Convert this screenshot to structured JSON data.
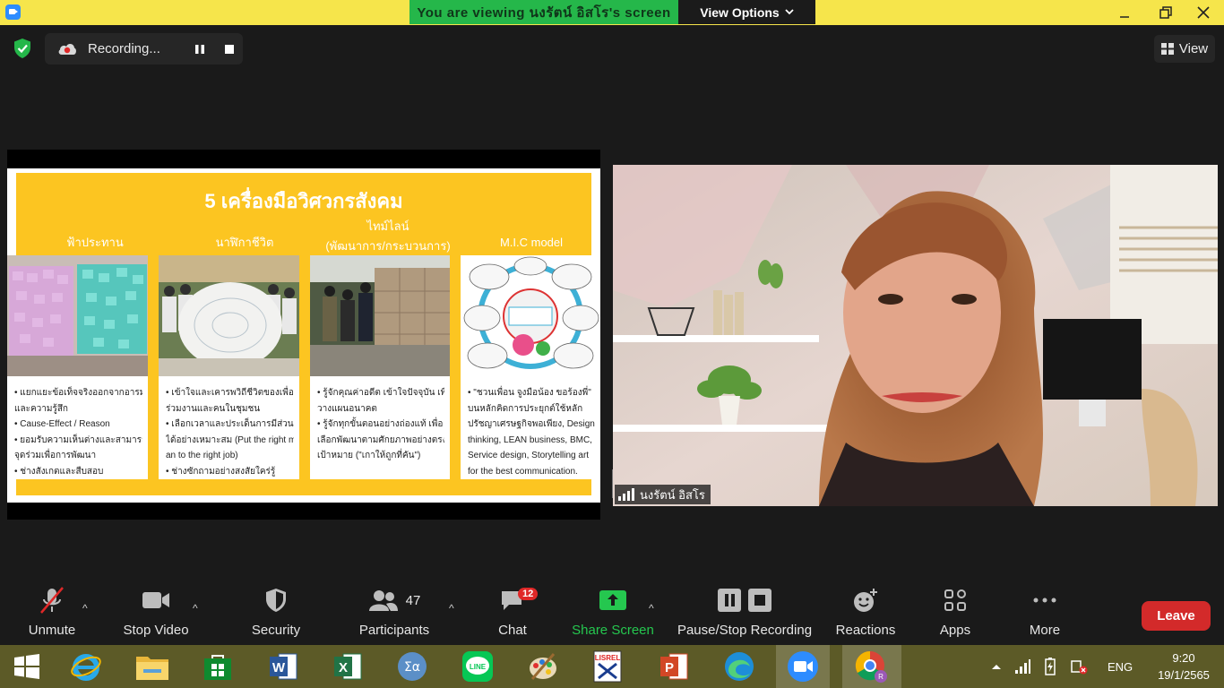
{
  "titlebar": {
    "banner_text": "You are viewing นงรัตน์ อิสโร's screen",
    "view_options": "View Options"
  },
  "recording": {
    "label": "Recording..."
  },
  "view_button": {
    "label": "View"
  },
  "slide": {
    "title": "5 เครื่องมือวิศวกรสังคม",
    "columns": [
      {
        "head": "ฟ้าประทาน",
        "lines": [
          "• แยกแยะข้อเท็จจริงออกจากอารมณ์",
          "  และความรู้สึก",
          "• Cause-Effect / Reason",
          "• ยอมรับความเห็นต่างและสามารถหา",
          "  จุดร่วมเพื่อการพัฒนา",
          "• ช่างสังเกตและสืบสอบ"
        ]
      },
      {
        "head": "นาฬิกาชีวิต",
        "lines": [
          "• เข้าใจและเคารพวิถีชีวิตของเพื่อน",
          "  ร่วมงานและคนในชุมชน",
          "• เลือกเวลาและประเด็นการมีส่วนร่วม",
          "  ได้อย่างเหมาะสม  (Put the right m",
          "  an to the right job)",
          "• ช่างซักถามอย่างสงสัยใคร่รู้"
        ]
      },
      {
        "head": "ไทม์ไลน์",
        "head2": "(พัฒนาการ/กระบวนการ)",
        "lines": [
          "• รู้จักคุณค่าอดีต เข้าใจปัจจุบัน เพื่อ",
          "  วางแผนอนาคต",
          "• รู้จักทุกขั้นตอนอย่างถ่องแท้  เพื่อ",
          "  เลือกพัฒนาตามศักยภาพอย่างตรง",
          "  เป้าหมาย (\"เกาให้ถูกที่คัน\")"
        ]
      },
      {
        "head": "M.I.C model",
        "lines": [
          "• \"ชวนเพื่อน จูงมือน้อง ขอร้องพี่\"",
          "  บนหลักคิดการประยุกต์ใช้หลัก",
          "  ปรัชญาเศรษฐกิจพอเพียง, Design",
          "  thinking, LEAN business, BMC,",
          "  Service design, Storytelling art",
          "  for the best communication."
        ]
      }
    ]
  },
  "participant": {
    "name": "นงรัตน์ อิสโร"
  },
  "toolbar": {
    "unmute": "Unmute",
    "stop_video": "Stop Video",
    "security": "Security",
    "participants": "Participants",
    "participants_count": "47",
    "chat": "Chat",
    "chat_badge": "12",
    "share_screen": "Share Screen",
    "pause_stop_recording": "Pause/Stop Recording",
    "reactions": "Reactions",
    "apps": "Apps",
    "more": "More",
    "leave": "Leave"
  },
  "taskbar": {
    "lang": "ENG",
    "time": "9:20",
    "date": "19/1/2565"
  },
  "colors": {
    "banner_green": "#25b74a",
    "share_green": "#25c74f",
    "leave_red": "#d32a2a",
    "slide_yellow": "#fcc521"
  }
}
